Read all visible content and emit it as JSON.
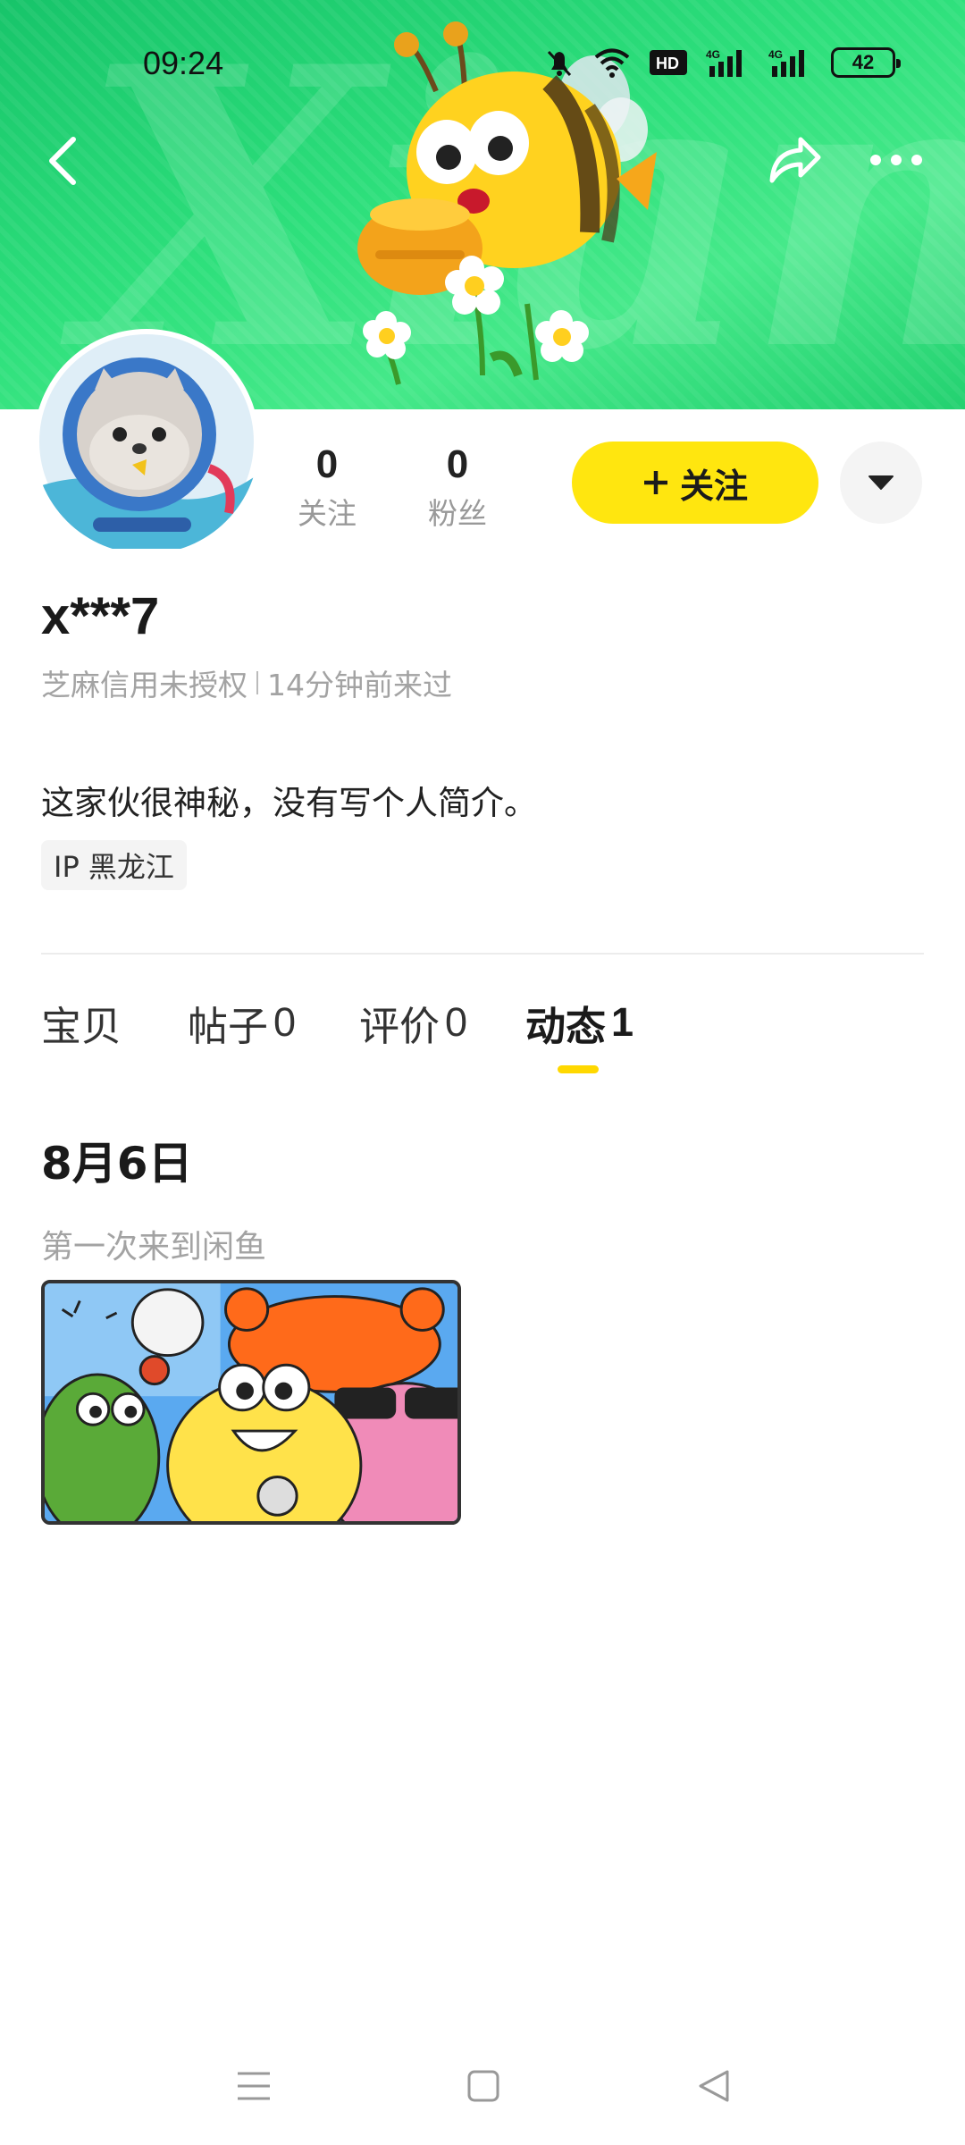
{
  "status_bar": {
    "time": "09:24",
    "battery": "42",
    "network_badge": "HD",
    "signal_label_1": "4G",
    "signal_label_2": "4G"
  },
  "header": {
    "banner_word": "Xianyu",
    "colors": {
      "banner": "#2ee07c",
      "accent": "#ffe60f"
    },
    "icons": [
      "back-arrow-icon",
      "share-icon",
      "more-icon"
    ]
  },
  "profile": {
    "following_count": "0",
    "following_label": "关注",
    "fans_count": "0",
    "fans_label": "粉丝",
    "follow_button_label": "关注",
    "follow_button_icon": "plus-icon",
    "username": "x***7",
    "credit_status": "芝麻信用未授权",
    "last_seen": "14分钟前来过",
    "bio": "这家伙很神秘，没有写个人简介。",
    "ip_label": "IP 黑龙江"
  },
  "tabs": [
    {
      "label": "宝贝",
      "count": ""
    },
    {
      "label": "帖子",
      "count": "0"
    },
    {
      "label": "评价",
      "count": "0"
    },
    {
      "label": "动态",
      "count": "1",
      "active": true
    }
  ],
  "timeline": {
    "date": "8月6日",
    "event_text": "第一次来到闲鱼"
  },
  "system_nav": {
    "icons": [
      "menu-icon",
      "home-square-icon",
      "back-triangle-icon"
    ]
  }
}
